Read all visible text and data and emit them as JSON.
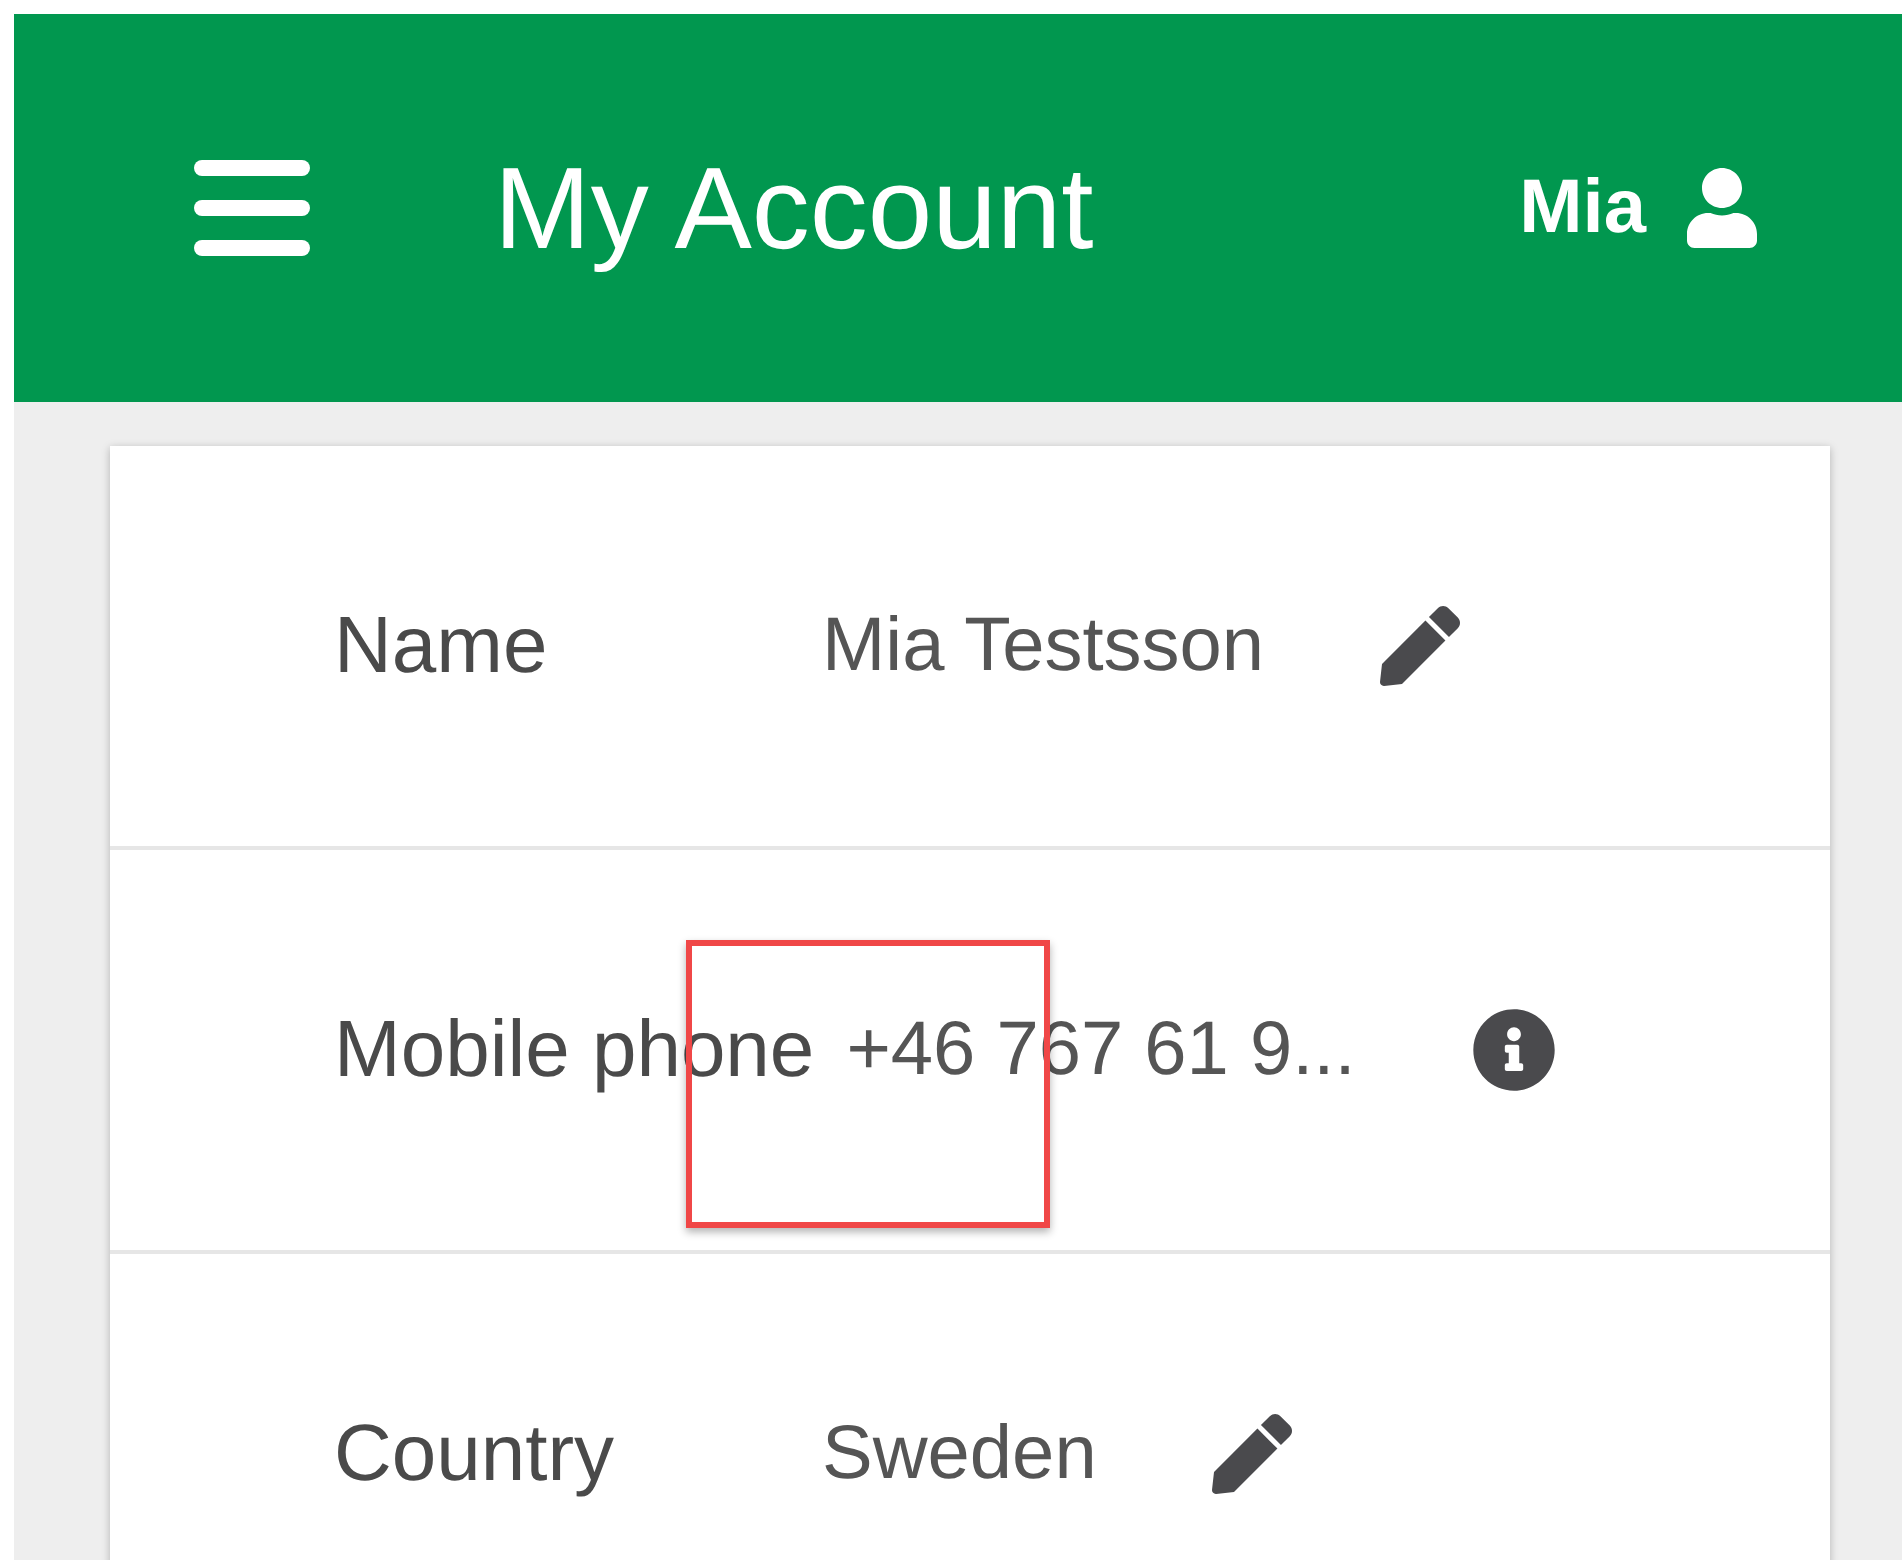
{
  "app_bar": {
    "title": "My Account",
    "user_name": "Mia"
  },
  "rows": [
    {
      "label": "Name",
      "value": "Mia Testsson",
      "kind": "editable"
    },
    {
      "label": "Mobile phone",
      "value": "+46 767 61 9...",
      "kind": "info",
      "highlighted": true
    },
    {
      "label": "Country",
      "value": "Sweden",
      "kind": "editable"
    }
  ]
}
